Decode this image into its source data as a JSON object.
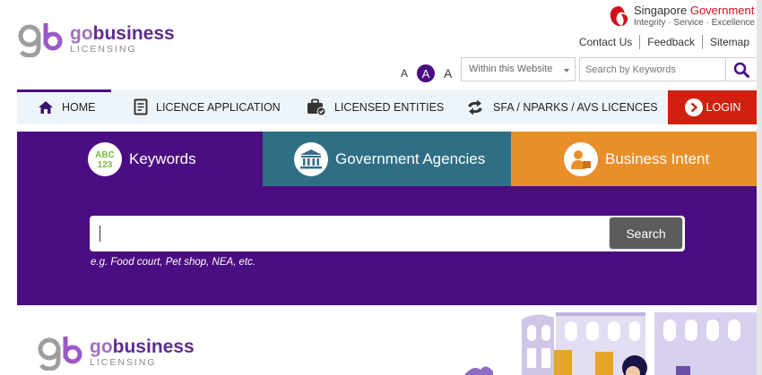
{
  "brand": {
    "go": "go",
    "business": "business",
    "licensing": "LICENSING"
  },
  "sg_gov": {
    "singapore": "Singapore",
    "government": "Government",
    "motto": "Integrity · Service · Excellence"
  },
  "top_links": [
    "Contact Us",
    "Feedback",
    "Sitemap"
  ],
  "font_size": {
    "small": "A",
    "medium": "A",
    "large": "A"
  },
  "site_search": {
    "scope": "Within this Website",
    "placeholder": "Search by Keywords"
  },
  "nav": {
    "home": "HOME",
    "licence_application": "LICENCE APPLICATION",
    "licensed_entities": "LICENSED ENTITIES",
    "sfa": "SFA / NPARKS / AVS LICENCES",
    "login": "LOGIN"
  },
  "hero": {
    "tabs": {
      "keywords": "Keywords",
      "agencies": "Government Agencies",
      "intent": "Business Intent"
    },
    "abc": "ABC",
    "num": "123",
    "search_value": "",
    "search_button": "Search",
    "hint": "e.g. Food court, Pet shop, NEA, etc."
  },
  "colors": {
    "purple": "#4b0d82",
    "teal": "#2f6f86",
    "orange": "#e88f2a",
    "login_red": "#d0200f"
  }
}
